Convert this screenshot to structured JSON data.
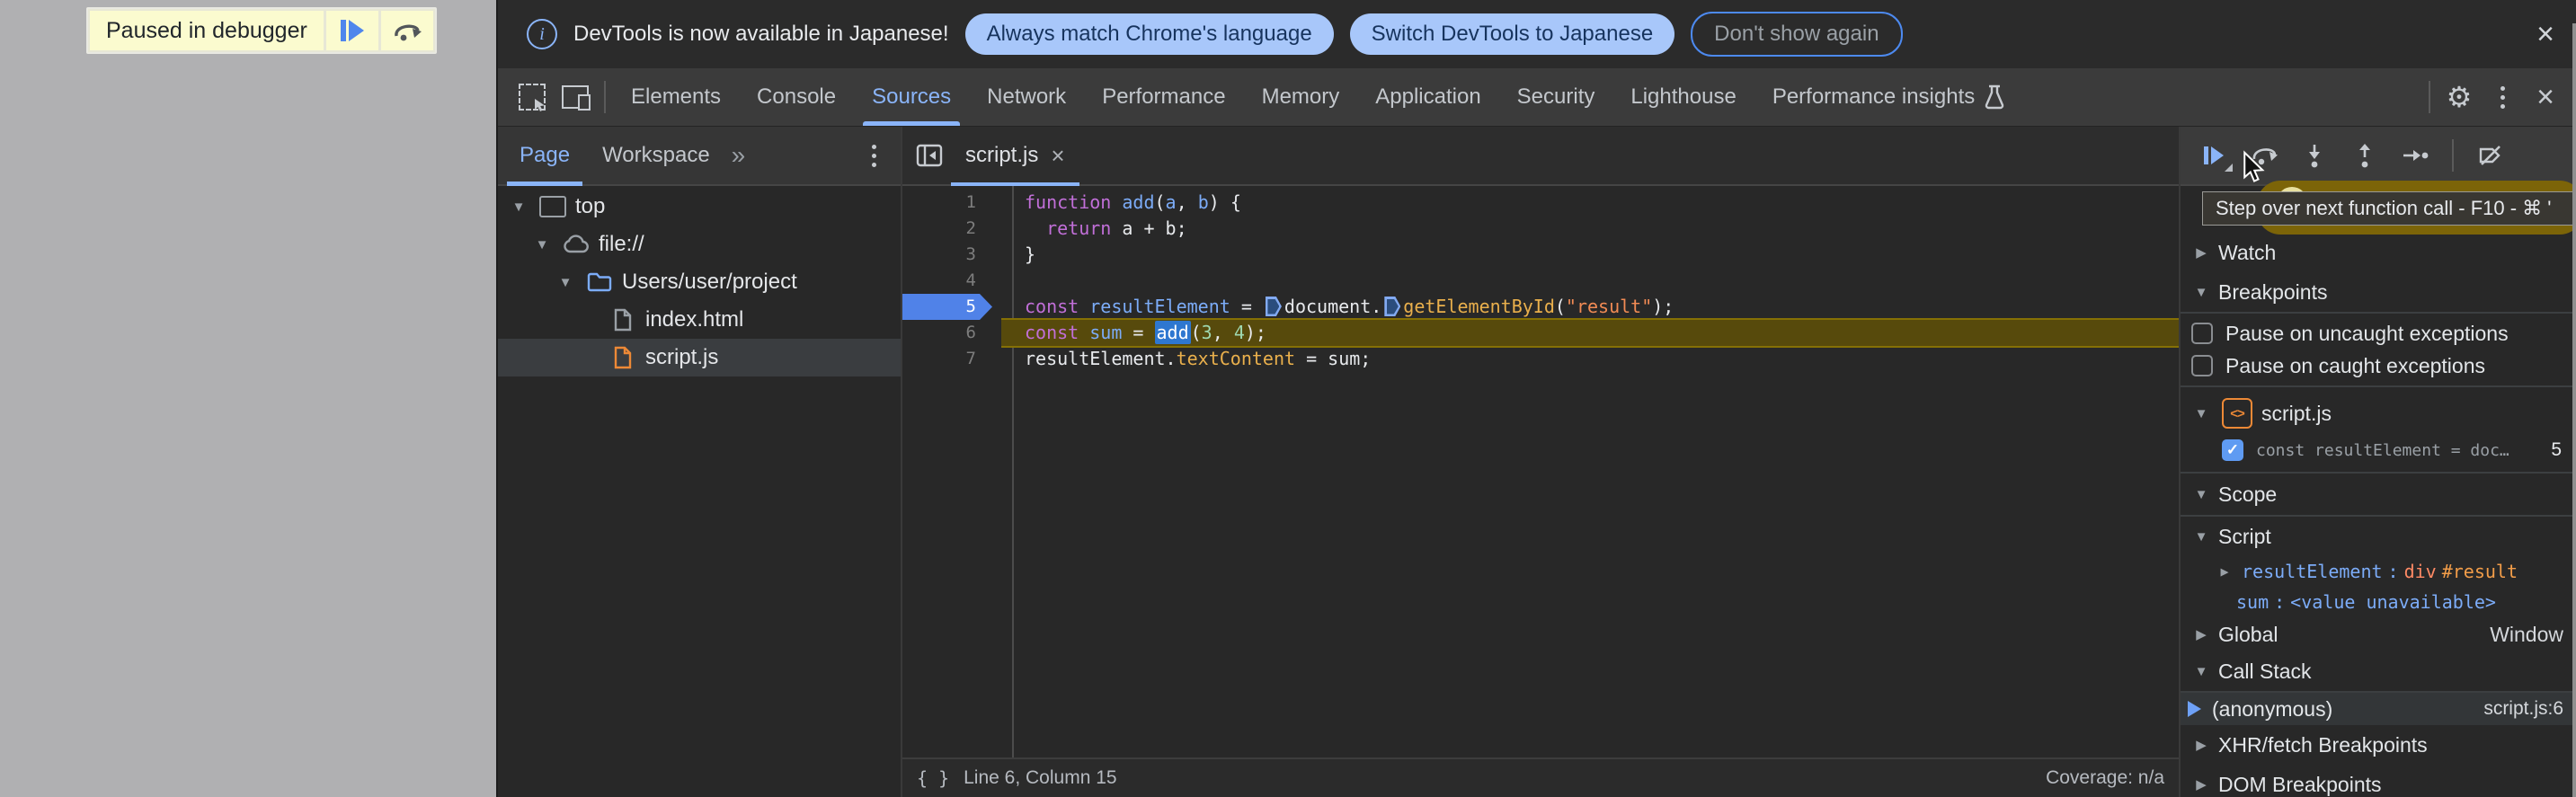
{
  "icons": {
    "expanded": "▼",
    "collapsed": "▶",
    "close": "×",
    "gear": "⚙",
    "more_tabs": "»",
    "check": "✓",
    "pretty_print": "{ }",
    "info": "i"
  },
  "toast": {
    "label": "Paused in debugger"
  },
  "infobar": {
    "message": "DevTools is now available in Japanese!",
    "match_button": "Always match Chrome's language",
    "switch_button": "Switch DevTools to Japanese",
    "dismiss_button": "Don't show again"
  },
  "toolbar": {
    "tabs": [
      "Elements",
      "Console",
      "Sources",
      "Network",
      "Performance",
      "Memory",
      "Application",
      "Security",
      "Lighthouse",
      "Performance insights"
    ],
    "active_tab": "Sources"
  },
  "navigator": {
    "page_tab": "Page",
    "workspace_tab": "Workspace",
    "tree": [
      {
        "label": "top"
      },
      {
        "label": "file://"
      },
      {
        "label": "Users/user/project"
      },
      {
        "label": "index.html"
      },
      {
        "label": "script.js"
      }
    ]
  },
  "editor": {
    "tab_label": "script.js",
    "lines": [
      {
        "n": "1",
        "tokens": [
          {
            "t": "function "
          },
          {
            "t": "add"
          },
          {
            "t": "("
          },
          {
            "t": "a"
          },
          {
            "t": ", "
          },
          {
            "t": "b"
          },
          {
            "t": ") {"
          }
        ]
      },
      {
        "n": "2",
        "tokens": [
          {
            "t": "  "
          },
          {
            "t": "return"
          },
          {
            "t": " a + b;"
          }
        ]
      },
      {
        "n": "3",
        "tokens": [
          {
            "t": "}"
          }
        ]
      },
      {
        "n": "4",
        "tokens": []
      },
      {
        "n": "5",
        "tokens": [
          {
            "t": "const "
          },
          {
            "t": "resultElement"
          },
          {
            "t": " = "
          },
          {
            "t": "document."
          },
          {
            "t": "getElementById"
          },
          {
            "t": "("
          },
          {
            "t": "\"result\""
          },
          {
            "t": ");"
          }
        ]
      },
      {
        "n": "6",
        "tokens": [
          {
            "t": "const "
          },
          {
            "t": "sum"
          },
          {
            "t": " = "
          },
          {
            "t": "add"
          },
          {
            "t": "("
          },
          {
            "t": "3"
          },
          {
            "t": ", "
          },
          {
            "t": "4"
          },
          {
            "t": ");"
          }
        ]
      },
      {
        "n": "7",
        "tokens": [
          {
            "t": "resultElement."
          },
          {
            "t": "textContent"
          },
          {
            "t": " = sum;"
          }
        ]
      }
    ],
    "status": {
      "line_col": "Line 6, Column 15",
      "coverage": "Coverage: n/a"
    }
  },
  "debugger": {
    "tooltip": "Step over next function call - F10 - ⌘ '",
    "watch": "Watch",
    "breakpoints": "Breakpoints",
    "pause_uncaught": "Pause on uncaught exceptions",
    "pause_caught": "Pause on caught exceptions",
    "bp_file": "script.js",
    "bp_badge": "<>",
    "bp_item": {
      "text": "const resultElement = doc…",
      "line": "5"
    },
    "scope": "Scope",
    "scope_script": "Script",
    "var1": {
      "name": "resultElement",
      "sep": ": ",
      "value_tag": "div",
      "value_id": "#result"
    },
    "var2": {
      "name": "sum",
      "sep": ": ",
      "value": "<value unavailable>"
    },
    "global": {
      "label": "Global",
      "value": "Window"
    },
    "call_stack": "Call Stack",
    "frame": {
      "name": "(anonymous)",
      "location": "script.js:6"
    },
    "xhr": "XHR/fetch Breakpoints",
    "dom": "DOM Breakpoints"
  },
  "colors": {
    "accent": "#8ab4f8",
    "button_bg": "#a8c7fa",
    "exec_line": "#574a0c",
    "breakpoint_blue": "#5082e8",
    "paused_banner": "#7c6408",
    "keyword": "#c16fd8",
    "string": "#f28b54",
    "number": "#9fd8b0",
    "function": "#eab04c"
  }
}
